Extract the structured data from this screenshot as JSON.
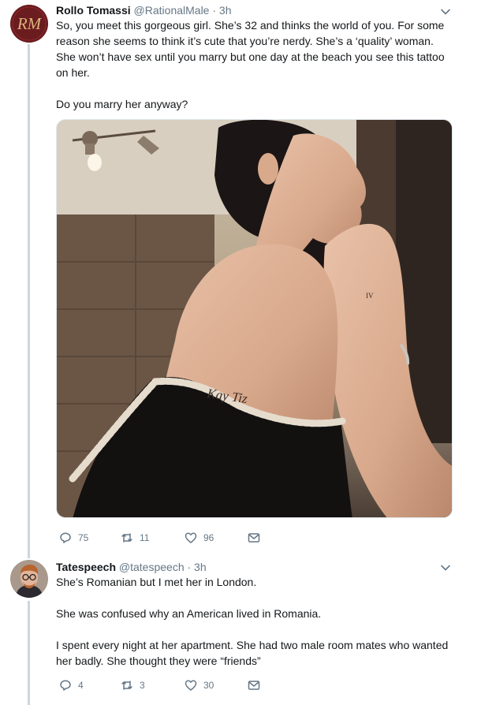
{
  "tweets": [
    {
      "name": "Rollo Tomassi",
      "handle": "@RationalMale",
      "time": "· 3h",
      "avatar_text": "RM",
      "paragraphs": [
        "So, you meet this gorgeous girl. She’s 32 and thinks the world of you. For some reason she seems to think it’s cute that you’re nerdy. She’s a ‘quality’ woman. She won’t have sex until you marry but one day at the beach you see this tattoo on her.",
        "Do you marry her anyway?"
      ],
      "tattoo_text": "Kay Tiz",
      "wrist_text": "IV",
      "replies": "75",
      "retweets": "11",
      "likes": "96"
    },
    {
      "name": "Tatespeech",
      "handle": "@tatespeech",
      "time": "· 3h",
      "paragraphs": [
        "She’s Romanian but I met her in London.",
        "She was confused why an American lived in Romania.",
        "I spent every night at her apartment. She had two male room mates who wanted her badly. She thought they were “friends”"
      ],
      "replies": "4",
      "retweets": "3",
      "likes": "30"
    }
  ],
  "colors": {
    "text": "#14171a",
    "secondary": "#657786",
    "thread_line": "#ccd6dd",
    "avatar_bg": "#6b1c1f",
    "avatar_fg": "#d9b47a"
  }
}
